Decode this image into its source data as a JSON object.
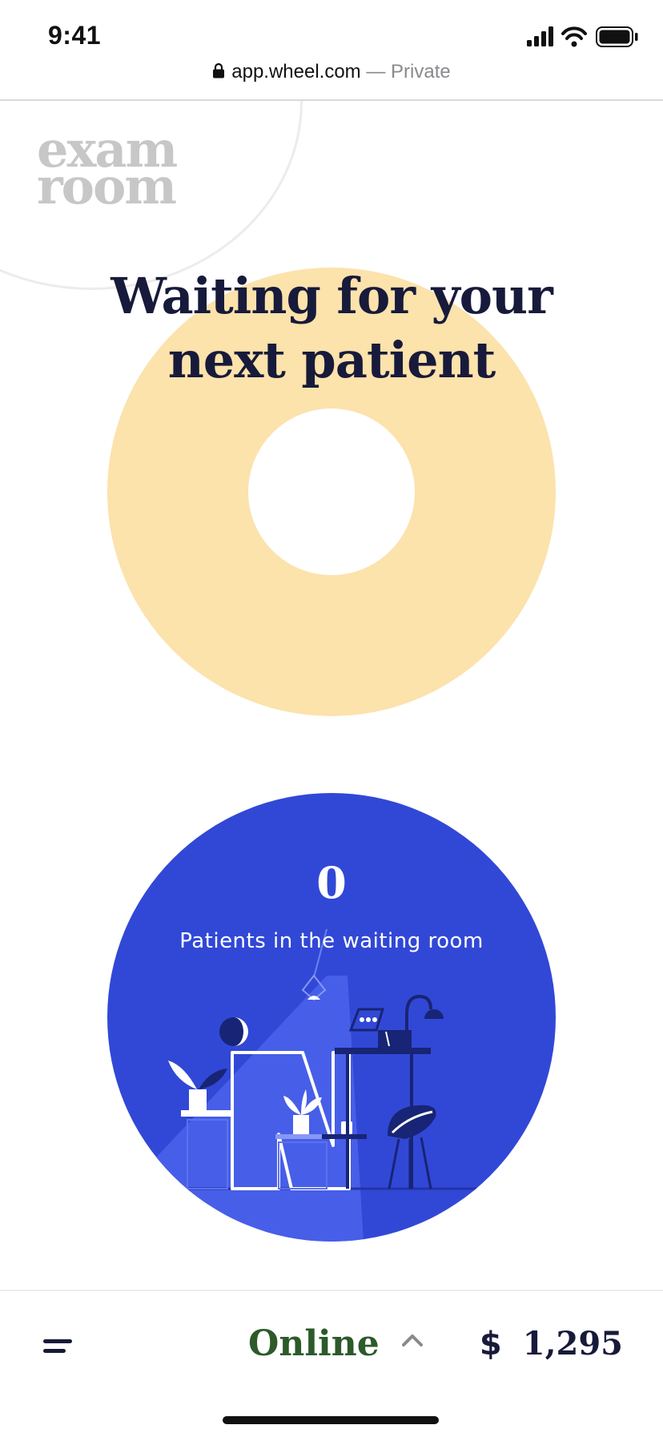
{
  "status_bar": {
    "time": "9:41",
    "icons": [
      "signal-icon",
      "wifi-icon",
      "battery-icon"
    ]
  },
  "url_bar": {
    "domain": "app.wheel.com",
    "separator": "—",
    "mode": "Private"
  },
  "logo": {
    "line1": "exam",
    "line2": "room"
  },
  "waiting_card": {
    "title_line1": "Waiting for your",
    "title_line2": "next patient"
  },
  "waiting_room": {
    "count": "0",
    "label": "Patients in the waiting room"
  },
  "bottom_bar": {
    "status_label": "Online",
    "currency_symbol": "$",
    "balance": "1,295"
  },
  "colors": {
    "accent_yellow": "#fce2ab",
    "accent_blue": "#3148d6",
    "text_dark": "#171a3a",
    "online_green": "#2d5a2a",
    "logo_gray": "#c7c7c7"
  }
}
